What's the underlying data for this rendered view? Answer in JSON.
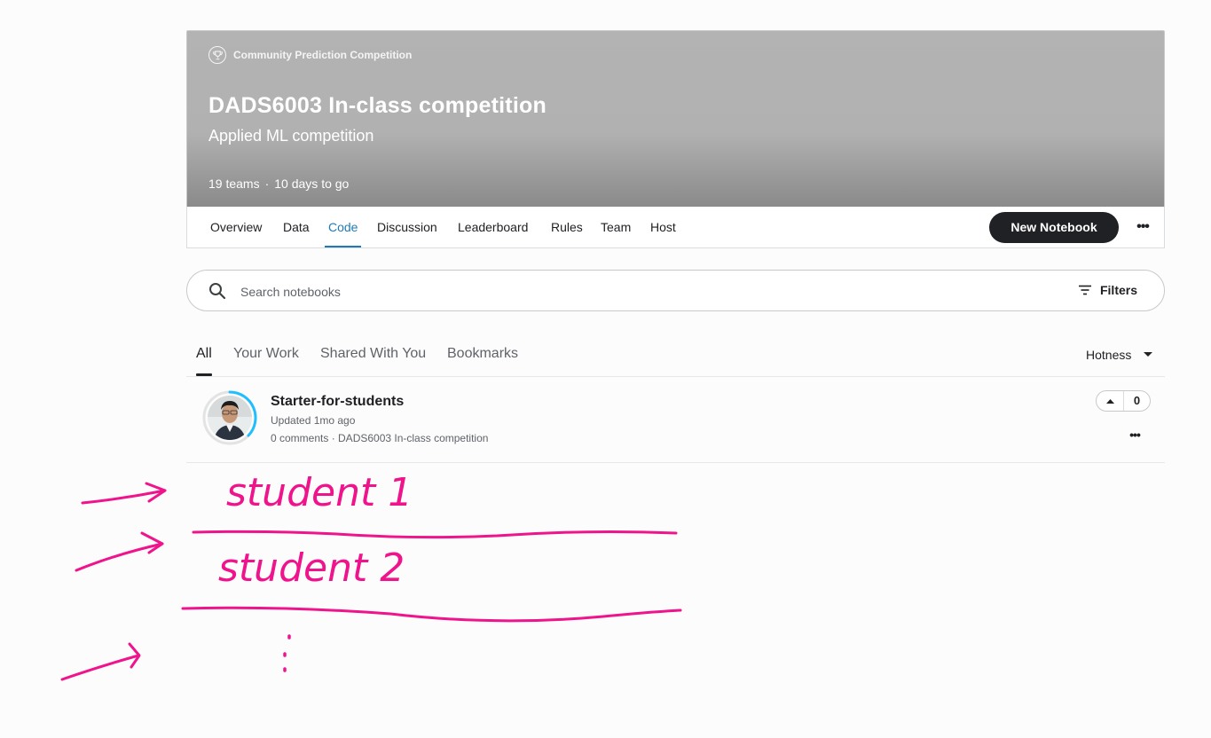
{
  "competition": {
    "type_label": "Community Prediction Competition",
    "title": "DADS6003 In-class competition",
    "subtitle": "Applied ML competition",
    "teams": "19 teams",
    "separator": "·",
    "time_left": "10 days to go"
  },
  "tabs": [
    {
      "label": "Overview"
    },
    {
      "label": "Data"
    },
    {
      "label": "Code"
    },
    {
      "label": "Discussion"
    },
    {
      "label": "Leaderboard"
    },
    {
      "label": "Rules"
    },
    {
      "label": "Team"
    },
    {
      "label": "Host"
    }
  ],
  "active_tab": "Code",
  "actions": {
    "new_notebook": "New Notebook",
    "more": "•••"
  },
  "search": {
    "placeholder": "Search notebooks",
    "value": "",
    "filters_label": "Filters"
  },
  "subtabs": [
    {
      "label": "All"
    },
    {
      "label": "Your Work"
    },
    {
      "label": "Shared With You"
    },
    {
      "label": "Bookmarks"
    }
  ],
  "sort": {
    "label": "Hotness"
  },
  "notebooks": [
    {
      "title": "Starter-for-students",
      "updated": "Updated 1mo ago",
      "meta": "0 comments · DADS6003 In-class competition",
      "votes": "0"
    }
  ],
  "annotations": {
    "color": "#f0148c",
    "row1": "student 1",
    "row2": "student 2"
  },
  "colors": {
    "accent": "#1f7ab8",
    "primary_button": "#202124",
    "banner": "#b1b1b1"
  }
}
